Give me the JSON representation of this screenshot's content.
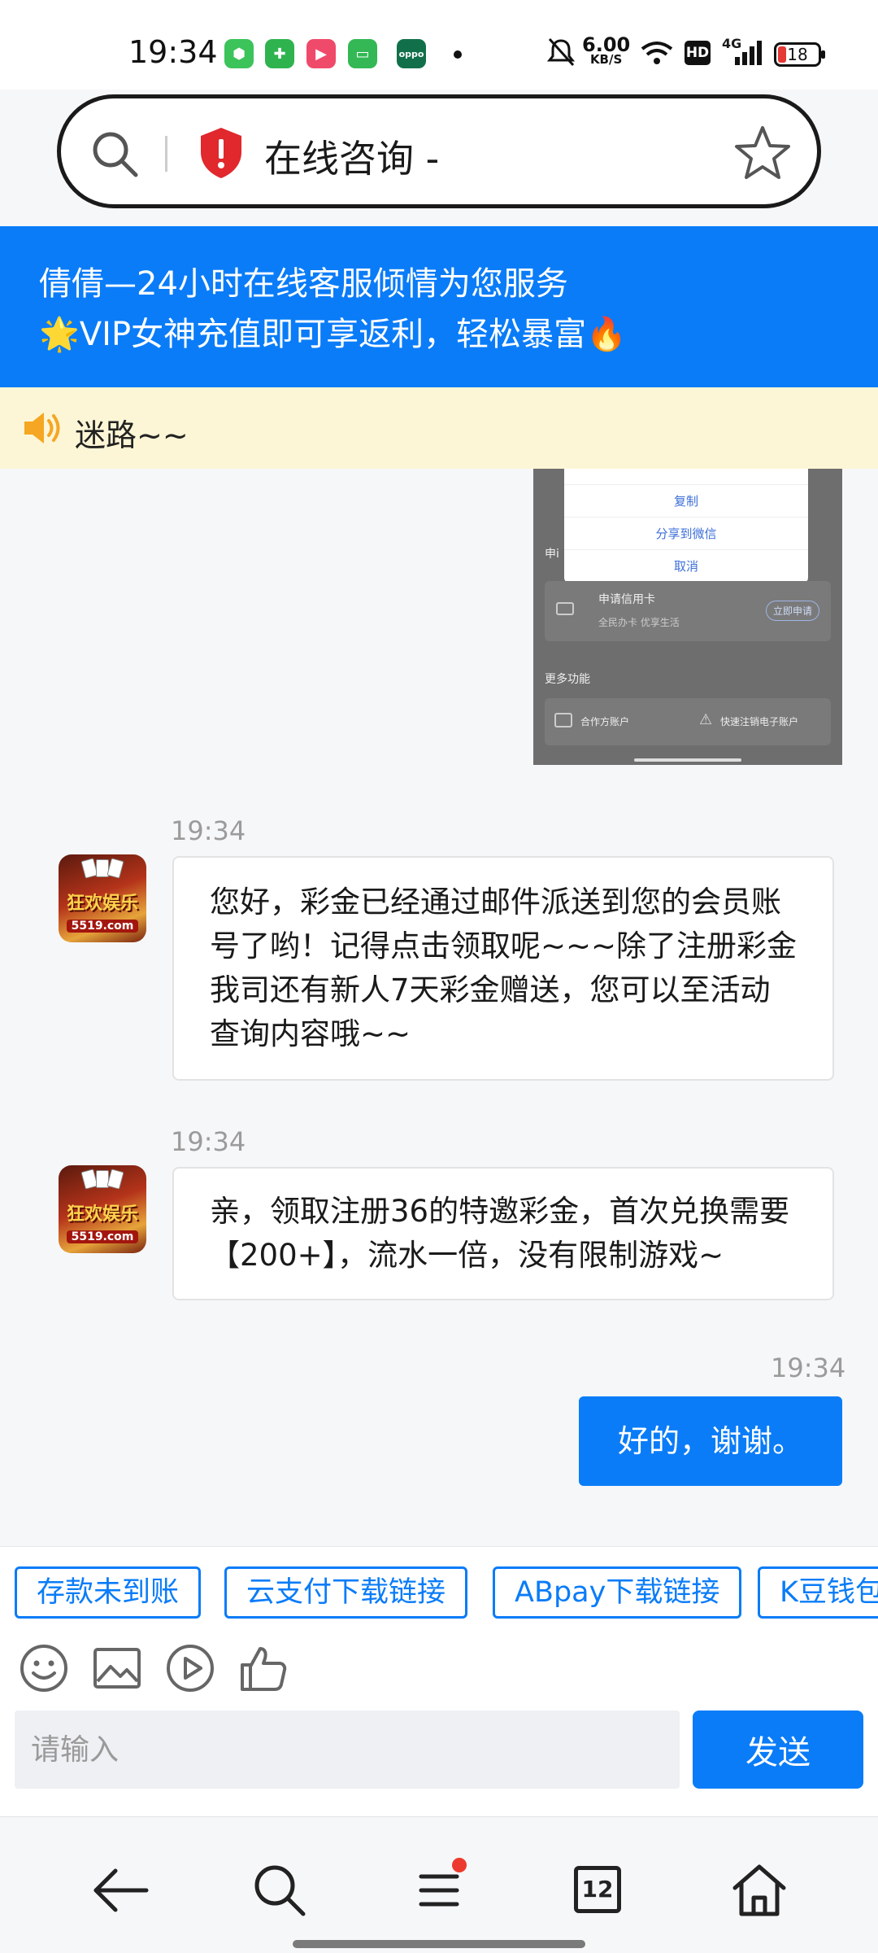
{
  "status_bar": {
    "time": "19:34",
    "network_speed_value": "6.00",
    "network_speed_unit": "KB/S",
    "hd_label": "HD",
    "signal_label": "4G",
    "battery_level": "18",
    "notification_icons": [
      "app-green-icon",
      "shield-green-icon",
      "video-red-icon",
      "chat-green-icon",
      "oppo-icon"
    ]
  },
  "browser": {
    "page_title": "在线咨询 -"
  },
  "banner": {
    "line1": "倩倩—24小时在线客服倾情为您服务",
    "line2": "🌟VIP女神充值即可享返利，轻松暴富🔥"
  },
  "notice": {
    "text": "迷路~~"
  },
  "screenshot_preview": {
    "menu_items": [
      "复制",
      "分享到微信",
      "取消"
    ],
    "section_label_partial": "申i",
    "credit_card_title": "申请信用卡",
    "credit_card_sub": "全民办卡 优享生活",
    "credit_card_button": "立即申请",
    "more_label": "更多功能",
    "func1": "合作方账户",
    "func2": "快速注销电子账户"
  },
  "messages": [
    {
      "time": "19:34",
      "sender": "agent",
      "avatar_text": "狂欢娱乐",
      "avatar_url": "5519.com",
      "text": "您好，彩金已经通过邮件派送到您的会员账号了哟！记得点击领取呢~~~除了注册彩金我司还有新人7天彩金赠送，您可以至活动查询内容哦~~"
    },
    {
      "time": "19:34",
      "sender": "agent",
      "avatar_text": "狂欢娱乐",
      "avatar_url": "5519.com",
      "text": "亲，领取注册36的特邀彩金，首次兑换需要【200+】，流水一倍，没有限制游戏~"
    },
    {
      "time": "19:34",
      "sender": "me",
      "text": "好的，谢谢。"
    }
  ],
  "quick_replies": [
    "存款未到账",
    "云支付下载链接",
    "ABpay下载链接",
    "K豆钱包"
  ],
  "toolbar_icons": [
    "emoji-icon",
    "image-icon",
    "video-icon",
    "thumbs-up-icon"
  ],
  "input": {
    "placeholder": "请输入",
    "value": "",
    "send_label": "发送"
  },
  "bottom_nav": {
    "tab_count": "12"
  },
  "colors": {
    "accent": "#0a7cf8",
    "notice_bg": "#fdf6d6",
    "badge_red": "#ec3b2e"
  }
}
